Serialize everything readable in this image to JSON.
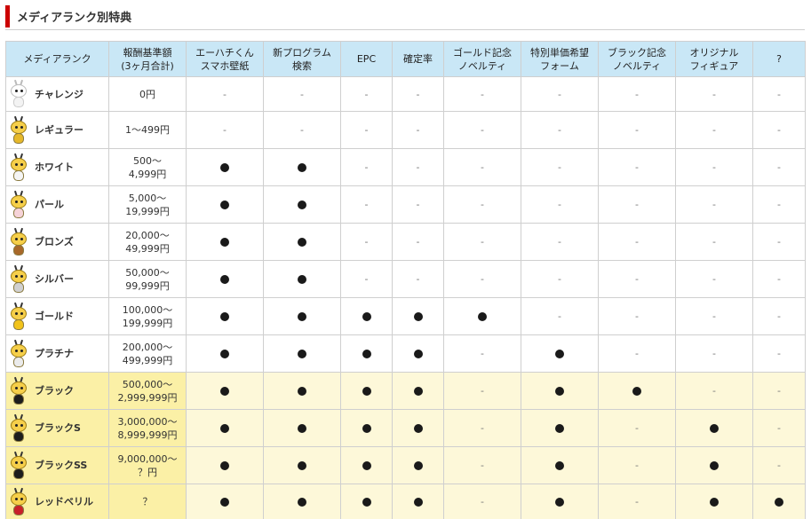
{
  "page": {
    "title": "メディアランク別特典"
  },
  "colors": {
    "accent": "#cc0000",
    "header_bg": "#c9e7f6",
    "highlight_row": "#fdf8d9",
    "highlight_cell": "#fbf0a6"
  },
  "table": {
    "headers": [
      "メディアランク",
      "報酬基準額\n(3ヶ月合計)",
      "エーハチくん\nスマホ壁紙",
      "新プログラム\n検索",
      "EPC",
      "確定率",
      "ゴールド記念\nノベルティ",
      "特別単価希望\nフォーム",
      "ブラック記念\nノベルティ",
      "オリジナル\nフィギュア",
      "?"
    ],
    "dash": "-",
    "rows": [
      {
        "rank": "チャレンジ",
        "amount": "0円",
        "icon": "mascot-white-icon",
        "body_color": "#f3f3f3",
        "perks": [
          false,
          false,
          false,
          false,
          false,
          false,
          false,
          false,
          false
        ]
      },
      {
        "rank": "レギュラー",
        "amount": "1～499円",
        "icon": "mascot-striped-icon",
        "body_color": "#e6b82a",
        "perks": [
          false,
          false,
          false,
          false,
          false,
          false,
          false,
          false,
          false
        ]
      },
      {
        "rank": "ホワイト",
        "amount": "500～\n4,999円",
        "icon": "mascot-white-shirt-icon",
        "body_color": "#f5f5f5",
        "perks": [
          true,
          true,
          false,
          false,
          false,
          false,
          false,
          false,
          false
        ]
      },
      {
        "rank": "パール",
        "amount": "5,000～\n19,999円",
        "icon": "mascot-pearl-icon",
        "body_color": "#f6d3d8",
        "perks": [
          true,
          true,
          false,
          false,
          false,
          false,
          false,
          false,
          false
        ]
      },
      {
        "rank": "ブロンズ",
        "amount": "20,000～\n49,999円",
        "icon": "mascot-bronze-icon",
        "body_color": "#a8682a",
        "perks": [
          true,
          true,
          false,
          false,
          false,
          false,
          false,
          false,
          false
        ]
      },
      {
        "rank": "シルバー",
        "amount": "50,000～\n99,999円",
        "icon": "mascot-silver-icon",
        "body_color": "#d0d0d0",
        "perks": [
          true,
          true,
          false,
          false,
          false,
          false,
          false,
          false,
          false
        ]
      },
      {
        "rank": "ゴールド",
        "amount": "100,000～\n199,999円",
        "icon": "mascot-gold-icon",
        "body_color": "#f2c31b",
        "perks": [
          true,
          true,
          true,
          true,
          true,
          false,
          false,
          false,
          false
        ]
      },
      {
        "rank": "プラチナ",
        "amount": "200,000～\n499,999円",
        "icon": "mascot-platinum-icon",
        "body_color": "#ebebeb",
        "perks": [
          true,
          true,
          true,
          true,
          false,
          true,
          false,
          false,
          false
        ]
      },
      {
        "rank": "ブラック",
        "amount": "500,000～\n2,999,999円",
        "icon": "mascot-black-icon",
        "body_color": "#1d1d1d",
        "highlight": true,
        "perks": [
          true,
          true,
          true,
          true,
          false,
          true,
          true,
          false,
          false
        ]
      },
      {
        "rank": "ブラックS",
        "amount": "3,000,000～\n8,999,999円",
        "icon": "mascot-black-s-icon",
        "body_color": "#1d1d1d",
        "highlight": true,
        "perks": [
          true,
          true,
          true,
          true,
          false,
          true,
          false,
          true,
          false
        ]
      },
      {
        "rank": "ブラックSS",
        "amount": "9,000,000～\n？円",
        "icon": "mascot-black-ss-icon",
        "body_color": "#1d1d1d",
        "highlight": true,
        "perks": [
          true,
          true,
          true,
          true,
          false,
          true,
          false,
          true,
          false
        ]
      },
      {
        "rank": "レッドベリル",
        "amount": "？",
        "icon": "mascot-red-beryl-icon",
        "body_color": "#c8202a",
        "highlight": true,
        "perks": [
          true,
          true,
          true,
          true,
          false,
          true,
          false,
          true,
          true
        ]
      }
    ]
  }
}
